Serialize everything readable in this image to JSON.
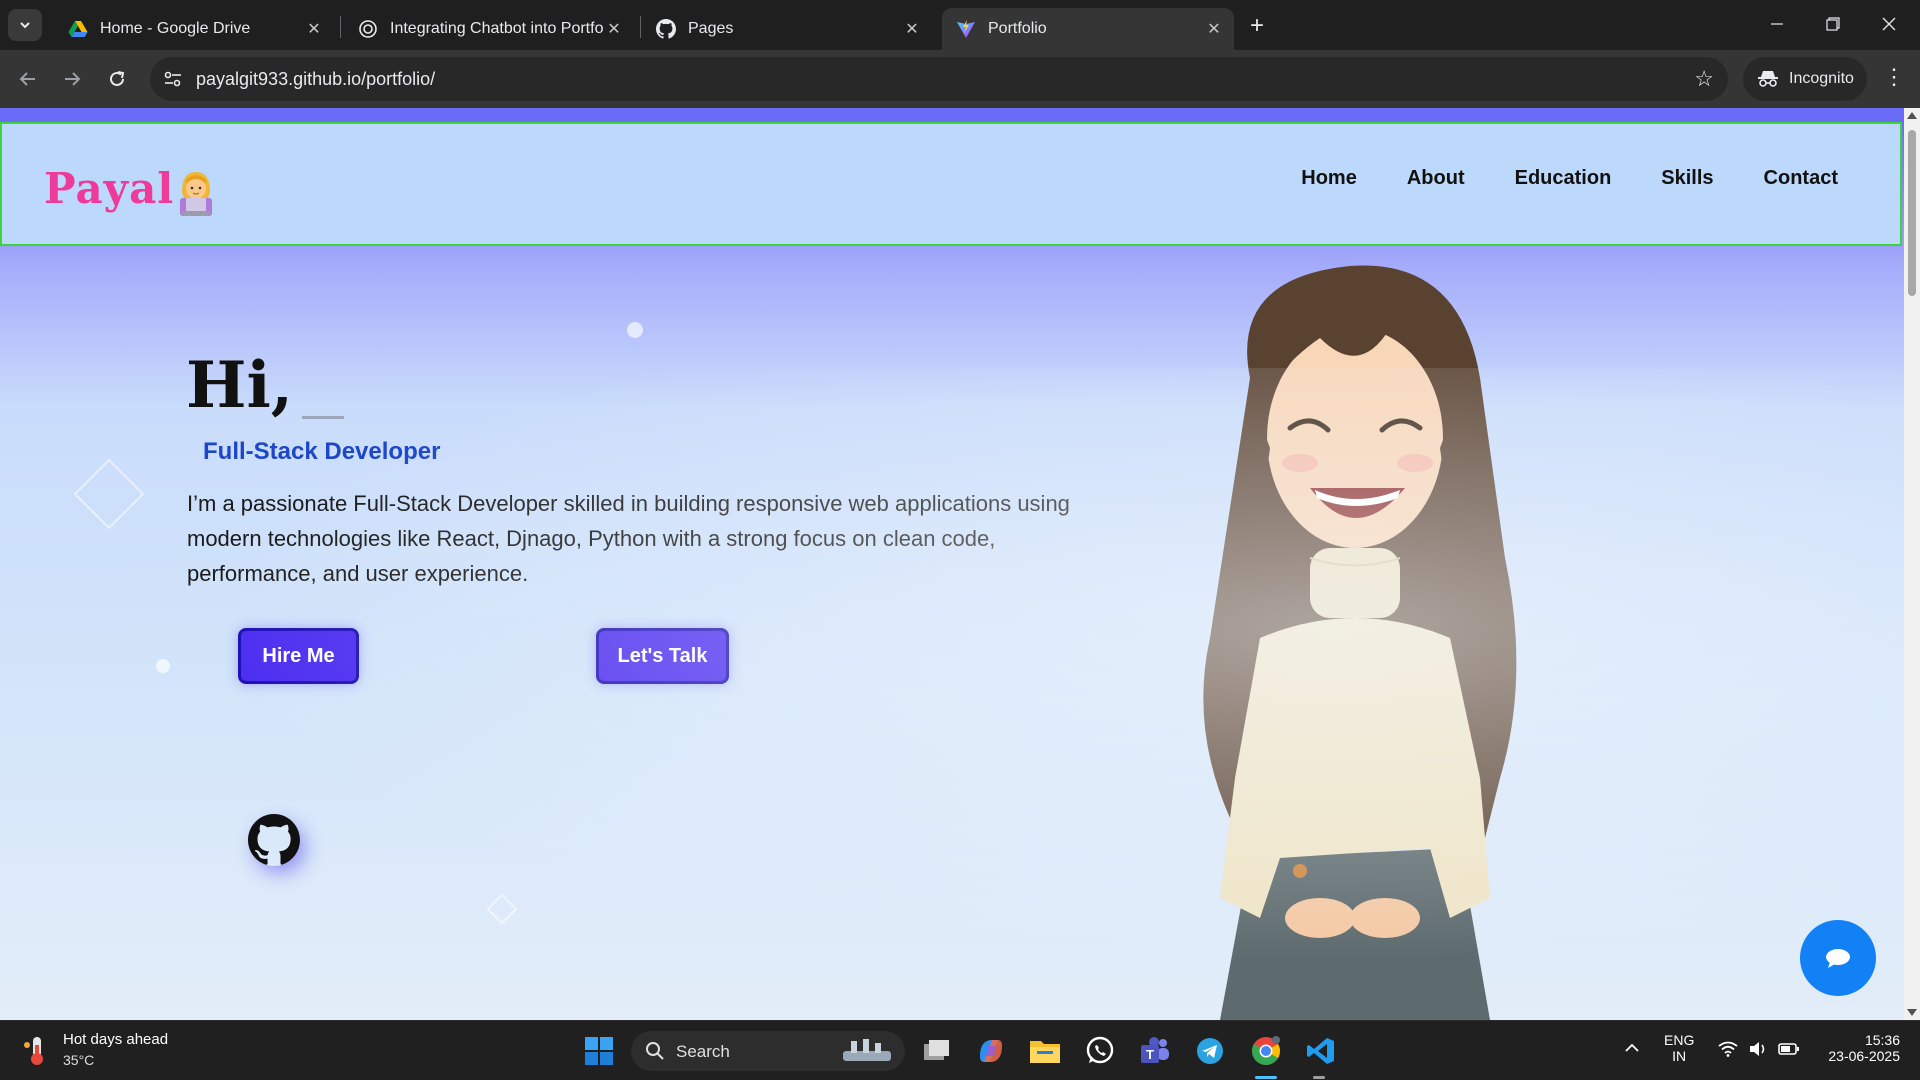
{
  "browser": {
    "tabs": [
      {
        "title": "Home - Google Drive",
        "icon": "google-drive-icon",
        "active": false
      },
      {
        "title": "Integrating Chatbot into Portfoli",
        "icon": "openai-icon",
        "active": false
      },
      {
        "title": "Pages",
        "icon": "github-icon",
        "active": false
      },
      {
        "title": "Portfolio",
        "icon": "vite-icon",
        "active": true
      }
    ],
    "url": "payalgit933.github.io/portfolio/",
    "incognito_label": "Incognito"
  },
  "site": {
    "logo": "Payal",
    "nav": [
      "Home",
      "About",
      "Education",
      "Skills",
      "Contact"
    ],
    "hero": {
      "greeting": "Hi,",
      "role": "Full-Stack Developer",
      "description": "I’m a passionate Full-Stack Developer skilled in building responsive web applications using modern technologies like React, Djnago, Python with a strong focus on clean code, performance, and user experience.",
      "hire_button": "Hire Me",
      "talk_button": "Let's Talk"
    },
    "colors": {
      "logo": "#ee3a9a",
      "role": "#1e46c8",
      "button": "#4b2cf0",
      "header_bg": "#bcd8fb",
      "header_border": "#3bd43b",
      "chat_fab": "#1181f5"
    }
  },
  "taskbar": {
    "weather_title": "Hot days ahead",
    "weather_temp": "35°C",
    "search_label": "Search",
    "lang_1": "ENG",
    "lang_2": "IN",
    "time": "15:36",
    "date": "23-06-2025"
  }
}
